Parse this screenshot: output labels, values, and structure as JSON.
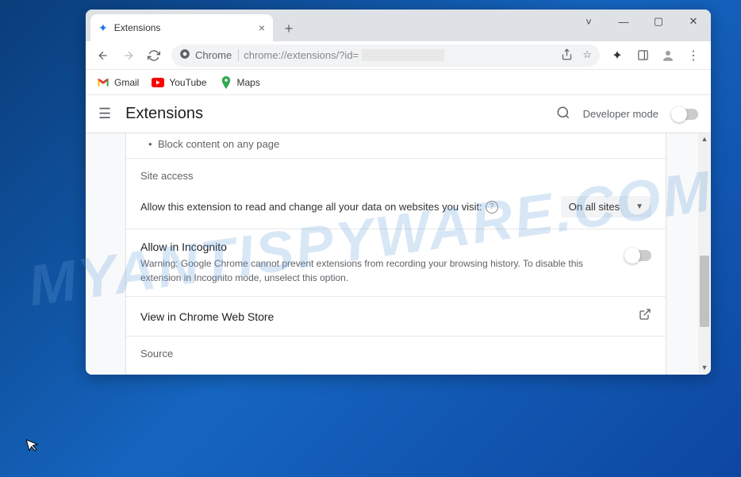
{
  "watermark": "MYANTISPYWARE.COM",
  "tab": {
    "title": "Extensions"
  },
  "address": {
    "chrome_label": "Chrome",
    "url_prefix": "chrome://extensions/?id="
  },
  "bookmarks": {
    "gmail": "Gmail",
    "youtube": "YouTube",
    "maps": "Maps"
  },
  "header": {
    "title": "Extensions",
    "dev_mode": "Developer mode"
  },
  "content": {
    "bullet1": "Block content on any page",
    "site_access_label": "Site access",
    "site_access_text": "Allow this extension to read and change all your data on websites you visit:",
    "site_access_value": "On all sites",
    "incognito_title": "Allow in Incognito",
    "incognito_desc": "Warning: Google Chrome cannot prevent extensions from recording your browsing history. To disable this extension in Incognito mode, unselect this option.",
    "webstore_link": "View in Chrome Web Store",
    "source_label": "Source"
  }
}
